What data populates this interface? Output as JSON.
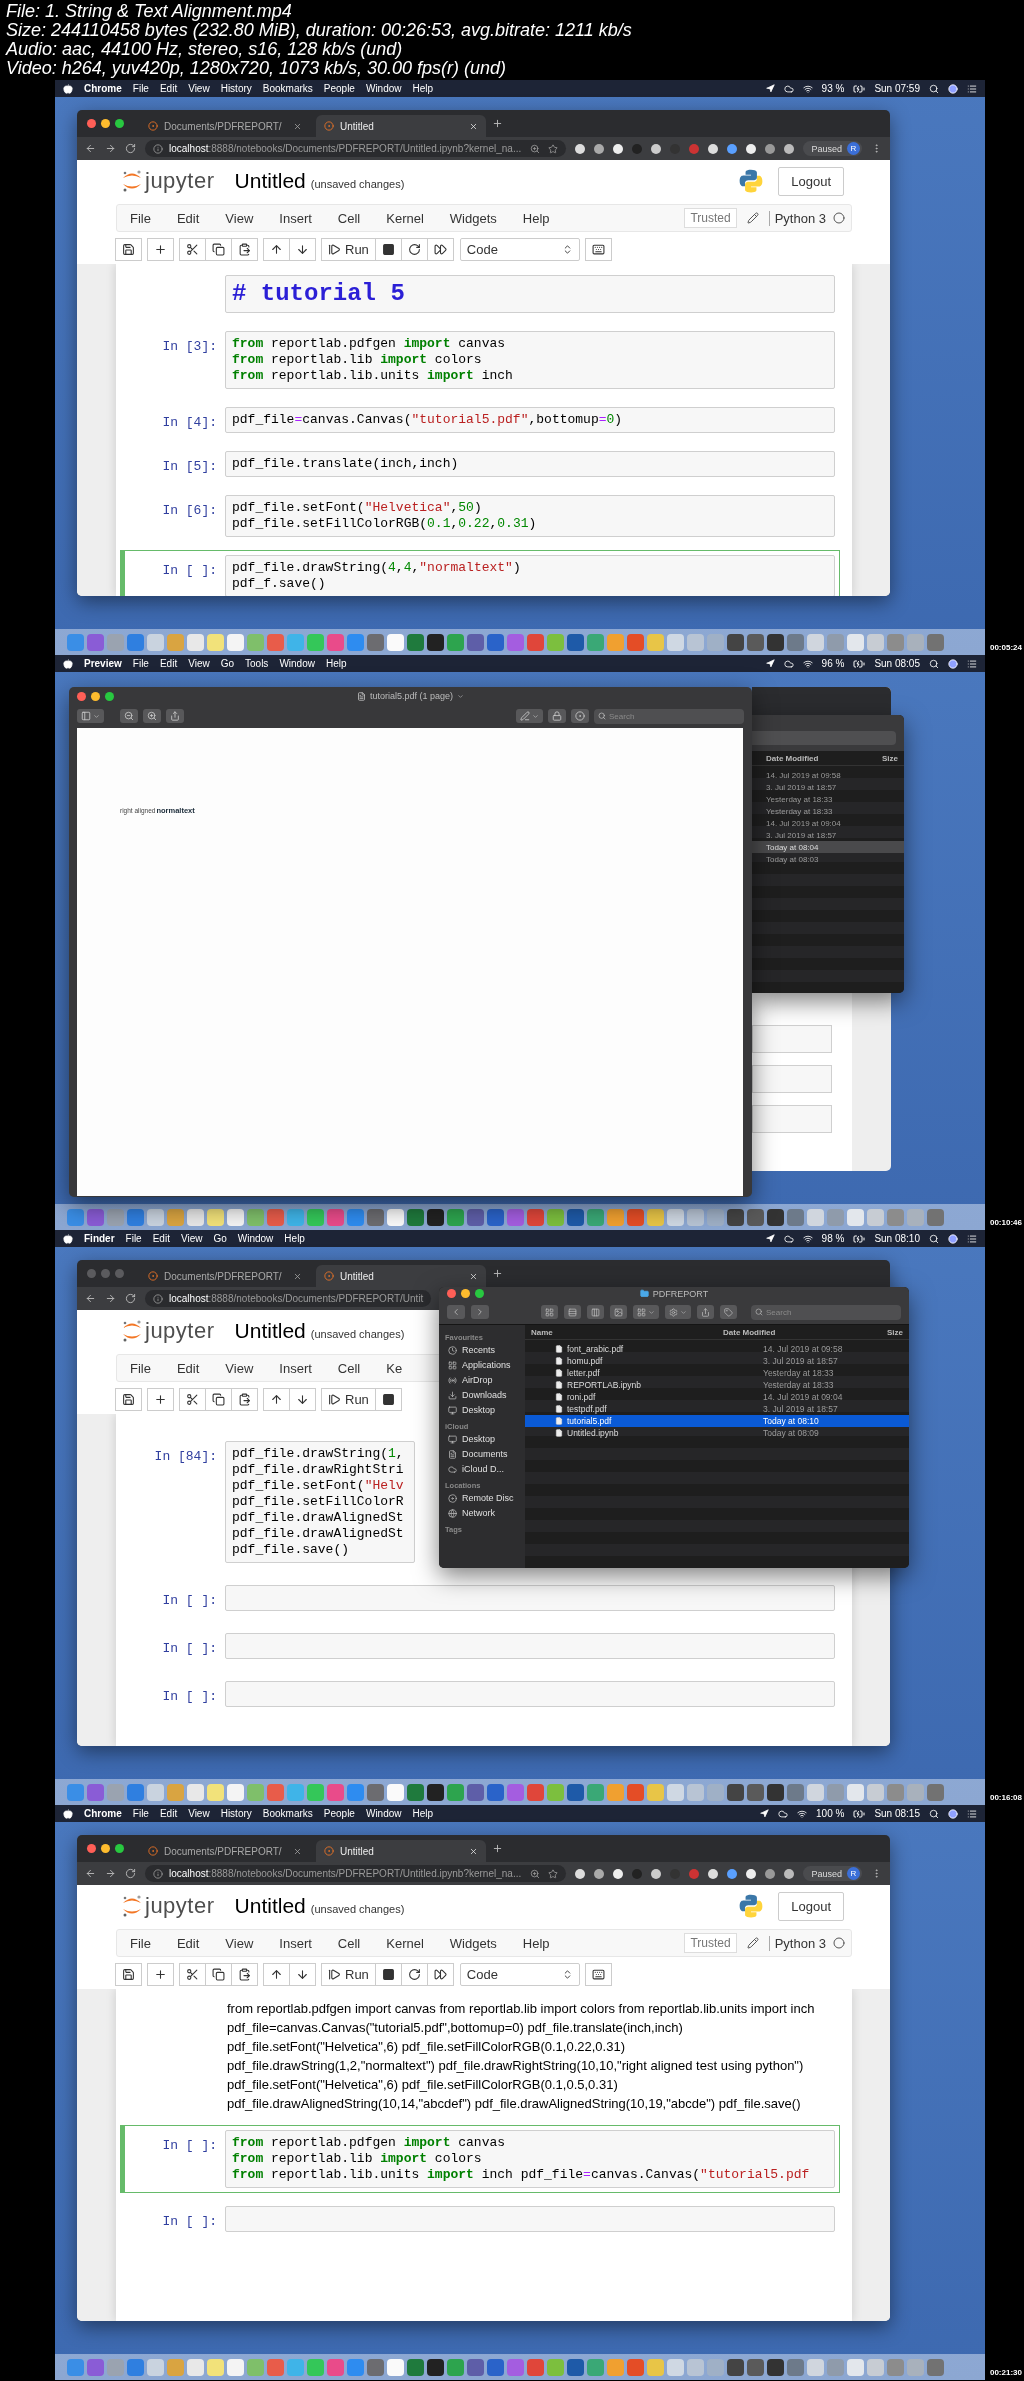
{
  "file_info": [
    "File: 1. String & Text Alignment.mp4",
    "Size: 244110458 bytes (232.80 MiB), duration: 00:26:53, avg.bitrate: 1211 kb/s",
    "Audio: aac, 44100 Hz, stereo, s16, 128 kb/s (und)",
    "Video: h264, yuv420p, 1280x720, 1073 kb/s, 30.00 fps(r) (und)"
  ],
  "frames": [
    {
      "kind": "notebook",
      "timestamp": "00:05:24",
      "menubar": {
        "app": "Chrome",
        "menus": [
          "File",
          "Edit",
          "View",
          "History",
          "Bookmarks",
          "People",
          "Window",
          "Help"
        ],
        "battery": "93 %",
        "clock": "Sun 07:59"
      },
      "browser": {
        "active": true,
        "tabs": [
          {
            "label": "Documents/PDFREPORT/",
            "selected": false
          },
          {
            "label": "Untitled",
            "selected": true
          }
        ],
        "url": "**localhost**:8888/notebooks/Documents/PDFREPORT/Untitled.ipynb?kernel_na...",
        "profile": {
          "label": "Paused",
          "initial": "R"
        }
      },
      "notebook": {
        "brand": "jupyter",
        "title": "Untitled",
        "status": "(unsaved changes)",
        "logout": "Logout",
        "menus": [
          "File",
          "Edit",
          "View",
          "Insert",
          "Cell",
          "Kernel",
          "Widgets",
          "Help"
        ],
        "trusted": "Trusted",
        "kernel": "Python 3",
        "toolbar": [
          [
            {
              "kind": "save"
            }
          ],
          [
            {
              "kind": "add"
            }
          ],
          [
            {
              "kind": "cut"
            },
            {
              "kind": "copy"
            },
            {
              "kind": "paste"
            }
          ],
          [
            {
              "kind": "up"
            },
            {
              "kind": "down"
            }
          ],
          [
            {
              "kind": "run",
              "label": "Run"
            },
            {
              "kind": "stop"
            },
            {
              "kind": "restart"
            },
            {
              "kind": "forward"
            }
          ],
          [
            {
              "kind": "select",
              "value": "Code"
            }
          ],
          [
            {
              "kind": "keyboard"
            }
          ]
        ],
        "cells": [
          {
            "kind": "heading",
            "text": "# tutorial 5",
            "selected": false
          },
          {
            "kind": "code",
            "prompt": "In [3]:",
            "selected": false,
            "lines": [
              [
                {
                  "text": "from",
                  "kind": "keyword"
                },
                {
                  "text": " reportlab.pdfgen ",
                  "kind": "plain"
                },
                {
                  "text": "import",
                  "kind": "keyword"
                },
                {
                  "text": " canvas",
                  "kind": "plain"
                }
              ],
              [
                {
                  "text": "from",
                  "kind": "keyword"
                },
                {
                  "text": " reportlab.lib ",
                  "kind": "plain"
                },
                {
                  "text": "import",
                  "kind": "keyword"
                },
                {
                  "text": " colors",
                  "kind": "plain"
                }
              ],
              [
                {
                  "text": "from",
                  "kind": "keyword"
                },
                {
                  "text": " reportlab.lib.units ",
                  "kind": "plain"
                },
                {
                  "text": "import",
                  "kind": "keyword"
                },
                {
                  "text": " inch",
                  "kind": "plain"
                }
              ]
            ]
          },
          {
            "kind": "code",
            "prompt": "In [4]:",
            "selected": false,
            "lines": [
              [
                {
                  "text": "pdf_file",
                  "kind": "plain"
                },
                {
                  "text": "=",
                  "kind": "operator"
                },
                {
                  "text": "canvas.Canvas(",
                  "kind": "plain"
                },
                {
                  "text": "\"tutorial5.pdf\"",
                  "kind": "string"
                },
                {
                  "text": ",bottomup",
                  "kind": "plain"
                },
                {
                  "text": "=",
                  "kind": "operator"
                },
                {
                  "text": "0",
                  "kind": "number"
                },
                {
                  "text": ")",
                  "kind": "plain"
                }
              ]
            ]
          },
          {
            "kind": "code",
            "prompt": "In [5]:",
            "selected": false,
            "lines": [
              [
                {
                  "text": "pdf_file.translate(inch,inch)",
                  "kind": "plain"
                }
              ]
            ]
          },
          {
            "kind": "code",
            "prompt": "In [6]:",
            "selected": false,
            "lines": [
              [
                {
                  "text": "pdf_file.setFont(",
                  "kind": "plain"
                },
                {
                  "text": "\"Helvetica\"",
                  "kind": "string"
                },
                {
                  "text": ",",
                  "kind": "plain"
                },
                {
                  "text": "50",
                  "kind": "number"
                },
                {
                  "text": ")",
                  "kind": "plain"
                }
              ],
              [
                {
                  "text": "pdf_file.setFillColorRGB(",
                  "kind": "plain"
                },
                {
                  "text": "0.1",
                  "kind": "number"
                },
                {
                  "text": ",",
                  "kind": "plain"
                },
                {
                  "text": "0.22",
                  "kind": "number"
                },
                {
                  "text": ",",
                  "kind": "plain"
                },
                {
                  "text": "0.31",
                  "kind": "number"
                },
                {
                  "text": ")",
                  "kind": "plain"
                }
              ]
            ]
          },
          {
            "kind": "code",
            "prompt": "In [ ]:",
            "selected": true,
            "lines": [
              [
                {
                  "text": "pdf_file.drawString(",
                  "kind": "plain"
                },
                {
                  "text": "4",
                  "kind": "number"
                },
                {
                  "text": ",",
                  "kind": "plain"
                },
                {
                  "text": "4",
                  "kind": "number"
                },
                {
                  "text": ",",
                  "kind": "plain"
                },
                {
                  "text": "\"normaltext\"",
                  "kind": "string"
                },
                {
                  "text": ")",
                  "kind": "plain"
                }
              ],
              [
                {
                  "text": "pdf_f.save()",
                  "kind": "plain"
                }
              ]
            ]
          }
        ]
      }
    },
    {
      "kind": "preview",
      "timestamp": "00:10:46",
      "menubar": {
        "app": "Preview",
        "menus": [
          "File",
          "Edit",
          "View",
          "Go",
          "Tools",
          "Window",
          "Help"
        ],
        "battery": "96 %",
        "clock": "Sun 08:05"
      },
      "preview": {
        "title": "tutorial5.pdf (1 page)",
        "search": {
          "placeholder": "Search"
        },
        "page_texts": [
          "right aligned",
          "normaltext"
        ]
      },
      "finder_behind": {
        "columns": [
          "Date Modified",
          "Size"
        ],
        "rows": [
          {
            "date": "14. Jul 2019 at 09:58",
            "selected": false
          },
          {
            "date": "3. Jul 2019 at 18:57",
            "selected": false
          },
          {
            "date": "Yesterday at 18:33",
            "selected": false
          },
          {
            "date": "Yesterday at 18:33",
            "selected": false
          },
          {
            "date": "14. Jul 2019 at 09:04",
            "selected": false
          },
          {
            "date": "3. Jul 2019 at 18:57",
            "selected": false
          },
          {
            "date": "Today at 08:04",
            "selected": true
          },
          {
            "date": "Today at 08:03",
            "selected": false
          }
        ]
      }
    },
    {
      "kind": "notebook",
      "timestamp": "00:16:08",
      "menubar": {
        "app": "Finder",
        "menus": [
          "File",
          "Edit",
          "View",
          "Go",
          "Window",
          "Help"
        ],
        "battery": "98 %",
        "clock": "Sun 08:10"
      },
      "browser": {
        "active": false,
        "tabs": [
          {
            "label": "Documents/PDFREPORT/",
            "selected": false
          },
          {
            "label": "Untitled",
            "selected": true
          }
        ],
        "url": "**localhost**:8888/notebooks/Documents/PDFREPORT/Untit"
      },
      "notebook": {
        "brand": "jupyter",
        "title": "Untitled",
        "status": "(unsaved changes)",
        "menus": [
          "File",
          "Edit",
          "View",
          "Insert",
          "Cell",
          "Ke"
        ],
        "toolbar": [
          [
            {
              "kind": "save"
            }
          ],
          [
            {
              "kind": "add"
            }
          ],
          [
            {
              "kind": "cut"
            },
            {
              "kind": "copy"
            },
            {
              "kind": "paste"
            }
          ],
          [
            {
              "kind": "up"
            },
            {
              "kind": "down"
            }
          ],
          [
            {
              "kind": "run",
              "label": "Run"
            },
            {
              "kind": "stop"
            }
          ]
        ],
        "cells": [
          {
            "kind": "code",
            "prompt": "In [84]:",
            "selected": false,
            "lines": [
              [
                {
                  "text": "pdf_file.drawString(",
                  "kind": "plain"
                },
                {
                  "text": "1",
                  "kind": "number"
                },
                {
                  "text": ",",
                  "kind": "plain"
                }
              ],
              [
                {
                  "text": "pdf_file.drawRightStri",
                  "kind": "plain"
                }
              ],
              [
                {
                  "text": "pdf_file.setFont(",
                  "kind": "plain"
                },
                {
                  "text": "\"Helv",
                  "kind": "string"
                }
              ],
              [
                {
                  "text": "pdf_file.setFillColorR",
                  "kind": "plain"
                }
              ],
              [
                {
                  "text": "pdf_file.drawAlignedSt",
                  "kind": "plain"
                }
              ],
              [
                {
                  "text": "pdf_file.drawAlignedSt",
                  "kind": "plain"
                }
              ],
              [
                {
                  "text": "pdf_file.save()",
                  "kind": "plain"
                }
              ]
            ]
          },
          {
            "kind": "code",
            "prompt": "In [ ]:",
            "selected": false
          },
          {
            "kind": "code",
            "prompt": "In [ ]:",
            "selected": false
          },
          {
            "kind": "code",
            "prompt": "In [ ]:",
            "selected": false
          }
        ]
      },
      "finder": {
        "title": "PDFREPORT",
        "search": {
          "placeholder": "Search"
        },
        "sidebar": [
          {
            "title": "Favourites",
            "items": [
              {
                "label": "Recents",
                "selected": false
              },
              {
                "label": "Applications",
                "selected": false
              },
              {
                "label": "AirDrop",
                "selected": false
              },
              {
                "label": "Downloads",
                "selected": false
              },
              {
                "label": "Desktop",
                "selected": false
              }
            ]
          },
          {
            "title": "iCloud",
            "items": [
              {
                "label": "Desktop",
                "selected": false
              },
              {
                "label": "Documents",
                "selected": false
              },
              {
                "label": "iCloud D...",
                "selected": false
              }
            ]
          },
          {
            "title": "Locations",
            "items": [
              {
                "label": "Remote Disc",
                "selected": false
              },
              {
                "label": "Network",
                "selected": false
              }
            ]
          },
          {
            "title": "Tags"
          }
        ],
        "columns": [
          "Name",
          "Date Modified",
          "Size"
        ],
        "files": [
          {
            "name": "font_arabic.pdf",
            "date": "14. Jul 2019 at 09:58",
            "selected": false
          },
          {
            "name": "homu.pdf",
            "date": "3. Jul 2019 at 18:57",
            "selected": false
          },
          {
            "name": "letter.pdf",
            "date": "Yesterday at 18:33",
            "selected": false
          },
          {
            "name": "REPORTLAB.ipynb",
            "date": "Yesterday at 18:33",
            "selected": false
          },
          {
            "name": "roni.pdf",
            "date": "14. Jul 2019 at 09:04",
            "selected": false
          },
          {
            "name": "testpdf.pdf",
            "date": "3. Jul 2019 at 18:57",
            "selected": false
          },
          {
            "name": "tutorial5.pdf",
            "date": "Today at 08:10",
            "selected": true
          },
          {
            "name": "Untitled.ipynb",
            "date": "Today at 08:09",
            "selected": false
          }
        ]
      }
    },
    {
      "kind": "notebook",
      "timestamp": "00:21:30",
      "menubar": {
        "app": "Chrome",
        "menus": [
          "File",
          "Edit",
          "View",
          "History",
          "Bookmarks",
          "People",
          "Window",
          "Help"
        ],
        "battery": "100 %",
        "clock": "Sun 08:15"
      },
      "browser": {
        "active": true,
        "tabs": [
          {
            "label": "Documents/PDFREPORT/",
            "selected": false
          },
          {
            "label": "Untitled",
            "selected": true
          }
        ],
        "url": "**localhost**:8888/notebooks/Documents/PDFREPORT/Untitled.ipynb?kernel_na...",
        "profile": {
          "label": "Paused",
          "initial": "R"
        }
      },
      "notebook": {
        "brand": "jupyter",
        "title": "Untitled",
        "status": "(unsaved changes)",
        "logout": "Logout",
        "menus": [
          "File",
          "Edit",
          "View",
          "Insert",
          "Cell",
          "Kernel",
          "Widgets",
          "Help"
        ],
        "trusted": "Trusted",
        "kernel": "Python 3",
        "toolbar": [
          [
            {
              "kind": "save"
            }
          ],
          [
            {
              "kind": "add"
            }
          ],
          [
            {
              "kind": "cut"
            },
            {
              "kind": "copy"
            },
            {
              "kind": "paste"
            }
          ],
          [
            {
              "kind": "up"
            },
            {
              "kind": "down"
            }
          ],
          [
            {
              "kind": "run",
              "label": "Run"
            },
            {
              "kind": "stop"
            },
            {
              "kind": "restart"
            },
            {
              "kind": "forward"
            }
          ],
          [
            {
              "kind": "select",
              "value": "Code"
            }
          ],
          [
            {
              "kind": "keyboard"
            }
          ]
        ],
        "cells": [
          {
            "kind": "text",
            "text": "from reportlab.pdfgen import canvas from reportlab.lib import colors from reportlab.lib.units import inch pdf_file=canvas.Canvas(\"tutorial5.pdf\",bottomup=0) pdf_file.translate(inch,inch) pdf_file.setFont(\"Helvetica\",6) pdf_file.setFillColorRGB(0.1,0.22,0.31) pdf_file.drawString(1,2,\"normaltext\") pdf_file.drawRightString(10,10,\"right aligned test using python\") pdf_file.setFont(\"Helvetica\",6) pdf_file.setFillColorRGB(0.1,0.5,0.31) pdf_file.drawAlignedString(10,14,\"abcdef\") pdf_file.drawAlignedString(10,19,\"abcde\") pdf_file.save()"
          },
          {
            "kind": "code",
            "prompt": "In [ ]:",
            "selected": true,
            "lines": [
              [
                {
                  "text": "from",
                  "kind": "keyword"
                },
                {
                  "text": " reportlab.pdfgen ",
                  "kind": "plain"
                },
                {
                  "text": "import",
                  "kind": "keyword"
                },
                {
                  "text": " canvas",
                  "kind": "plain"
                }
              ],
              [
                {
                  "text": "from",
                  "kind": "keyword"
                },
                {
                  "text": " reportlab.lib ",
                  "kind": "plain"
                },
                {
                  "text": "import",
                  "kind": "keyword"
                },
                {
                  "text": " colors",
                  "kind": "plain"
                }
              ],
              [
                {
                  "text": "from",
                  "kind": "keyword"
                },
                {
                  "text": " reportlab.lib.units ",
                  "kind": "plain"
                },
                {
                  "text": "import",
                  "kind": "keyword"
                },
                {
                  "text": " inch pdf_file",
                  "kind": "plain"
                },
                {
                  "text": "=",
                  "kind": "operator"
                },
                {
                  "text": "canvas.Canvas(",
                  "kind": "plain"
                },
                {
                  "text": "\"tutorial5.pdf",
                  "kind": "string"
                }
              ]
            ]
          },
          {
            "kind": "code",
            "prompt": "In [ ]:",
            "selected": false
          }
        ]
      }
    }
  ]
}
